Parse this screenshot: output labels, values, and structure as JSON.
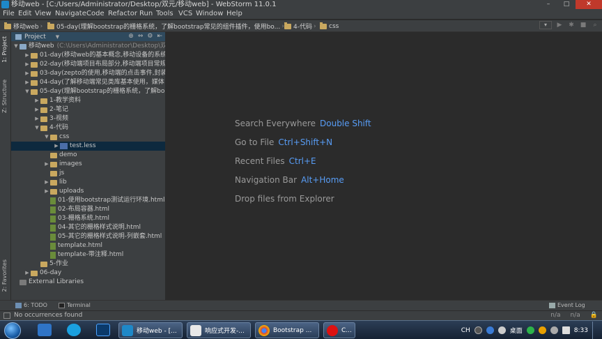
{
  "window": {
    "title": "移动web - [C:/Users/Administrator/Desktop/双元/移动web] - WebStorm 11.0.1",
    "buttons": [
      "–",
      "□",
      "✕"
    ]
  },
  "menu": [
    "File",
    "Edit",
    "View",
    "Navigate",
    "Code",
    "Refactor",
    "Run",
    "Tools",
    "VCS",
    "Window",
    "Help"
  ],
  "breadcrumb": [
    "移动web",
    "05-day(理解bootstrap的栅格系统，了解bootstrap常见的组件插件，使用bo...",
    "4-代码",
    "css"
  ],
  "side_tabs": {
    "project": "1: Project",
    "structure": "Z: Structure",
    "favorites": "2: Favorites"
  },
  "project_panel": {
    "header": "Project",
    "rows": [
      {
        "label": "移动web",
        "extra": "(C:\\Users\\Administrator\\Desktop\\双",
        "icon": "project-folder-icon",
        "expanded": "▼"
      },
      {
        "label": "01-day(移动web的基本概念,移动设备的系统",
        "icon": "folder-icon",
        "expanded": "▶"
      },
      {
        "label": "02-day(移动端项目布局部分,移动端项目常规",
        "icon": "folder-icon",
        "expanded": "▶"
      },
      {
        "label": "03-day(zepto的使用,移动端的点击事件,封装",
        "icon": "folder-icon",
        "expanded": "▶"
      },
      {
        "label": "04-day(了解移动端常见类库基本使用，媒体",
        "icon": "folder-icon",
        "expanded": "▶"
      },
      {
        "label": "05-day(理解bootstrap的栅格系统，了解bo",
        "icon": "folder-icon",
        "expanded": "▼"
      },
      {
        "label": "1-教学资料",
        "icon": "folder-icon",
        "expanded": "▶"
      },
      {
        "label": "2-笔记",
        "icon": "folder-icon",
        "expanded": "▶"
      },
      {
        "label": "3-视频",
        "icon": "folder-icon",
        "expanded": "▶"
      },
      {
        "label": "4-代码",
        "icon": "folder-icon",
        "expanded": "▼"
      },
      {
        "label": "css",
        "icon": "folder-icon",
        "expanded": "▼"
      },
      {
        "label": "test.less",
        "icon": "less-file-icon",
        "expanded": "▶"
      },
      {
        "label": "demo",
        "icon": "folder-icon",
        "expanded": ""
      },
      {
        "label": "images",
        "icon": "folder-icon",
        "expanded": "▶"
      },
      {
        "label": "js",
        "icon": "folder-icon",
        "expanded": ""
      },
      {
        "label": "lib",
        "icon": "folder-icon",
        "expanded": "▶"
      },
      {
        "label": "uploads",
        "icon": "folder-icon",
        "expanded": "▶"
      },
      {
        "label": "01-使用bootstrap测试运行环境.html",
        "icon": "html-file-icon",
        "expanded": ""
      },
      {
        "label": "02-布局容器.html",
        "icon": "html-file-icon",
        "expanded": ""
      },
      {
        "label": "03-栅格系统.html",
        "icon": "html-file-icon",
        "expanded": ""
      },
      {
        "label": "04-其它的栅格样式说明.html",
        "icon": "html-file-icon",
        "expanded": ""
      },
      {
        "label": "05-其它的栅格样式说明-列嵌套.html",
        "icon": "html-file-icon",
        "expanded": ""
      },
      {
        "label": "template.html",
        "icon": "html-file-icon",
        "expanded": ""
      },
      {
        "label": "template-带注释.html",
        "icon": "html-file-icon",
        "expanded": ""
      },
      {
        "label": "5-作业",
        "icon": "folder-icon",
        "expanded": ""
      },
      {
        "label": "06-day",
        "icon": "folder-icon",
        "expanded": "▶"
      },
      {
        "label": "External Libraries",
        "icon": "library-icon",
        "expanded": ""
      }
    ]
  },
  "editor_hints": [
    {
      "text": "Search Everywhere",
      "key": "Double Shift"
    },
    {
      "text": "Go to File",
      "key": "Ctrl+Shift+N"
    },
    {
      "text": "Recent Files",
      "key": "Ctrl+E"
    },
    {
      "text": "Navigation Bar",
      "key": "Alt+Home"
    },
    {
      "text": "Drop files from Explorer",
      "key": ""
    }
  ],
  "tool_windows": {
    "todo": "6: TODO",
    "terminal": "Terminal",
    "event_log": "Event Log"
  },
  "status": {
    "message": "No occurrences found",
    "right": [
      "n/a",
      "n/a"
    ]
  },
  "taskbar": {
    "tasks": [
      "移动web - [...",
      "响应式开发-...",
      "Bootstrap ...",
      "C..."
    ],
    "tray": {
      "lang": "CH",
      "desktop": "桌面",
      "clock": "8:33"
    }
  },
  "colors": {
    "accent": "#589df6",
    "selection": "#0d293e",
    "panel": "#3c3f41",
    "editor": "#2b2b2b"
  }
}
